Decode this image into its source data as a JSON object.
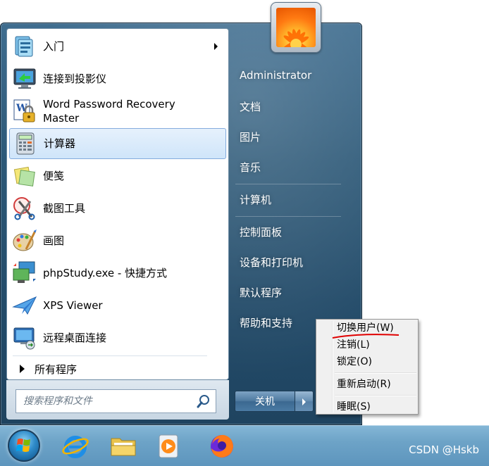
{
  "programs": [
    {
      "label": "入门",
      "icon": "getting-started-icon",
      "has_submenu": true
    },
    {
      "label": "连接到投影仪",
      "icon": "projector-icon"
    },
    {
      "label": "Word Password Recovery Master",
      "icon": "word-password-icon"
    },
    {
      "label": "计算器",
      "icon": "calculator-icon",
      "highlighted": true
    },
    {
      "label": "便笺",
      "icon": "sticky-notes-icon"
    },
    {
      "label": "截图工具",
      "icon": "snipping-tool-icon"
    },
    {
      "label": "画图",
      "icon": "paint-icon"
    },
    {
      "label": "phpStudy.exe - 快捷方式",
      "icon": "phpstudy-icon"
    },
    {
      "label": "XPS Viewer",
      "icon": "xps-viewer-icon"
    },
    {
      "label": "远程桌面连接",
      "icon": "remote-desktop-icon"
    }
  ],
  "all_programs_label": "所有程序",
  "search": {
    "placeholder": "搜索程序和文件"
  },
  "right_pane": {
    "user": "Administrator",
    "documents": "文档",
    "pictures": "图片",
    "music": "音乐",
    "computer": "计算机",
    "control_panel": "控制面板",
    "devices_printers": "设备和打印机",
    "default_programs": "默认程序",
    "help_support": "帮助和支持"
  },
  "shutdown_label": "关机",
  "context_menu": {
    "switch_user": "切换用户(W)",
    "log_off": "注销(L)",
    "lock": "锁定(O)",
    "restart": "重新启动(R)",
    "sleep": "睡眠(S)"
  },
  "watermark": "CSDN @Hskb",
  "colors": {
    "accent_underline": "#e00000",
    "highlight_border": "#84acdd"
  }
}
